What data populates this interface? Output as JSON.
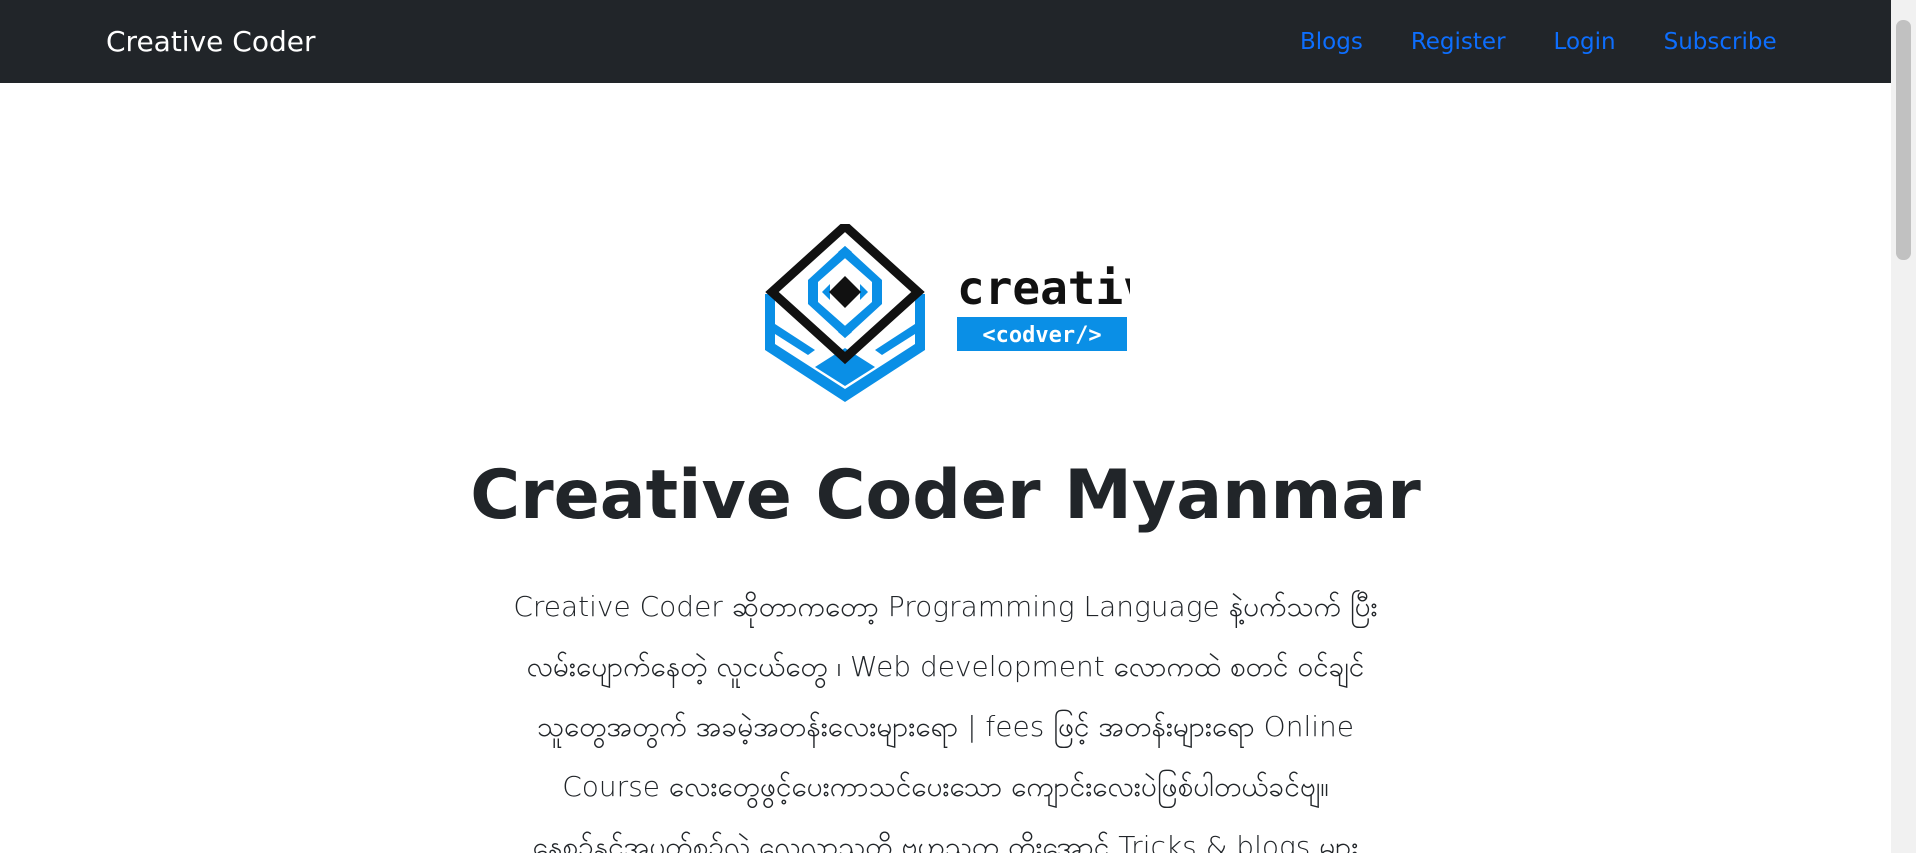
{
  "navbar": {
    "brand": "Creative Coder",
    "links": [
      {
        "label": "Blogs"
      },
      {
        "label": "Register"
      },
      {
        "label": "Login"
      },
      {
        "label": "Subscribe"
      }
    ]
  },
  "hero": {
    "logo": {
      "word": "creative",
      "tag": "<codver/>"
    },
    "title": "Creative Coder Myanmar",
    "description_lines": [
      "Creative Coder ဆိုတာကတော့ Programming Language နဲ့ပက်သက် ပြီး",
      "လမ်းပျောက်နေတဲ့ လူငယ်တွေ ၊ Web development လောကထဲ စတင် ဝင်ချင်",
      "သူတွေအတွက် အခမဲ့အတန်းလေးများရော | fees ဖြင့် အတန်းများရော Online",
      "Course လေးတွေဖွင့်ပေးကာသင်ပေးသော ကျောင်းလေးပဲဖြစ်ပါတယ်ခင်ဗျ။",
      "နေ့စဉ်နှင့်အပတ်စဉ်လဲ လေ့လာသတိ ဗဟုသုတ တိုးအောင် Tricks & blogs များ"
    ]
  },
  "colors": {
    "navbar_bg": "#212529",
    "link": "#0d6efd",
    "logo_blue": "#0a8fe6",
    "logo_dark": "#111111"
  }
}
